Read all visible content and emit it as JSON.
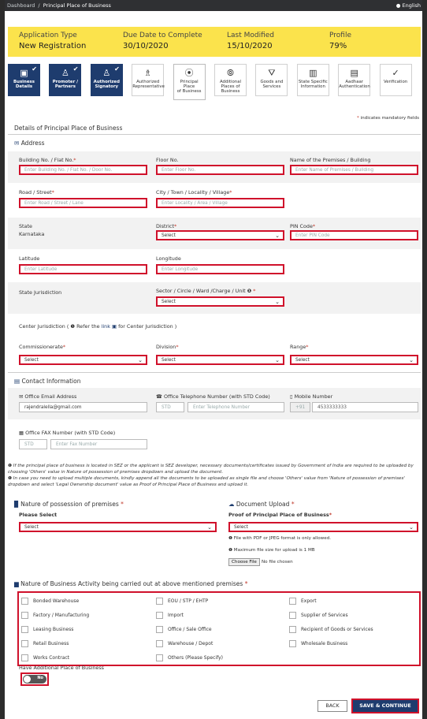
{
  "breadcrumb": {
    "home": "Dashboard",
    "current": "Principal Place of Business"
  },
  "language": "English",
  "info": [
    {
      "label": "Application Type",
      "value": "New Registration"
    },
    {
      "label": "Due Date to Complete",
      "value": "30/10/2020"
    },
    {
      "label": "Last Modified",
      "value": "15/10/2020"
    },
    {
      "label": "Profile",
      "value": "79%"
    }
  ],
  "steps": [
    {
      "l1": "Business",
      "l2": "Details",
      "icon": "briefcase-icon",
      "state": "done"
    },
    {
      "l1": "Promoter /",
      "l2": "Partners",
      "icon": "user-icon",
      "state": "done"
    },
    {
      "l1": "Authorized",
      "l2": "Signatory",
      "icon": "user-check-icon",
      "state": "done"
    },
    {
      "l1": "Authorized",
      "l2": "Representative",
      "icon": "users-icon",
      "state": ""
    },
    {
      "l1": "Principal Place",
      "l2": "of Business",
      "icon": "location-pin-icon",
      "state": "active"
    },
    {
      "l1": "Additional",
      "l2": "Places of",
      "l3": "Business",
      "icon": "map-pin-icon",
      "state": ""
    },
    {
      "l1": "Goods and",
      "l2": "Services",
      "icon": "goods-icon",
      "state": ""
    },
    {
      "l1": "State Specific",
      "l2": "Information",
      "icon": "document-icon",
      "state": ""
    },
    {
      "l1": "Aadhaar",
      "l2": "Authentication",
      "icon": "id-card-icon",
      "state": ""
    },
    {
      "l1": "Verification",
      "l2": "",
      "icon": "check-circle-icon",
      "state": ""
    }
  ],
  "mandatory_note": "indicates mandatory fields",
  "page_title": "Details of Principal Place of Business",
  "address_header": "Address",
  "fields": {
    "building": {
      "label": "Building No. / Flat No.",
      "placeholder": "Enter Building No. / Flat No. / Door No."
    },
    "floor": {
      "label": "Floor No.",
      "placeholder": "Enter Floor No."
    },
    "premises": {
      "label": "Name of the Premises / Building",
      "placeholder": "Enter Name of Premises / Building"
    },
    "road": {
      "label": "Road / Street",
      "placeholder": "Enter Road / Street / Lane"
    },
    "city": {
      "label": "City / Town / Locality / Village",
      "placeholder": "Enter Locality / Area / Village"
    },
    "state": {
      "label": "State",
      "value": "Karnataka"
    },
    "district": {
      "label": "District",
      "value": "Select"
    },
    "pin": {
      "label": "PIN Code",
      "placeholder": "Enter PIN Code"
    },
    "latitude": {
      "label": "Latitude",
      "placeholder": "Enter Latitude"
    },
    "longitude": {
      "label": "Longitude",
      "placeholder": "Enter Longitude"
    },
    "state_juris": {
      "label": "State Jurisdiction"
    },
    "sector": {
      "label": "Sector / Circle / Ward /Charge / Unit",
      "value": "Select"
    },
    "center_juris": {
      "prefix": "Center Jurisdiction ( ",
      "refer": "Refer the",
      "link": "link",
      "suffix": "for Center Jurisdiction )"
    },
    "commissionerate": {
      "label": "Commissionerate",
      "value": "Select"
    },
    "division": {
      "label": "Division",
      "value": "Select"
    },
    "range": {
      "label": "Range",
      "value": "Select"
    }
  },
  "contact": {
    "header": "Contact Information",
    "email_label": "Office Email Address",
    "email_value": "rajendralella@gmail.com",
    "phone_label": "Office Telephone Number (with STD Code)",
    "std_placeholder": "STD",
    "phone_placeholder": "Enter Telephone Number",
    "mobile_label": "Mobile Number",
    "mobile_code": "+91",
    "mobile_value": "4533333333",
    "fax_label": "Office FAX Number (with STD Code)",
    "fax_std": "STD",
    "fax_placeholder": "Enter Fax Number"
  },
  "notes": {
    "n1": "If the principal place of business is located in SEZ or the applicant is SEZ developer, necessary documents/certificates issued by Government of India are required to be uploaded by choosing 'Others' value in Nature of possession of premises dropdown and upload the document.",
    "n2": "In case you need to upload multiple documents, kindly append all the documents to be uploaded as single file and choose 'Others' value from 'Nature of possession of premises' dropdown and select 'Legal Ownership document' value as Proof of Principal Place of Business and upload it."
  },
  "possession": {
    "header": "Nature of possession of premises",
    "label": "Please Select",
    "value": "Select"
  },
  "upload": {
    "header": "Document Upload",
    "label": "Proof of Principal Place of Business",
    "value": "Select",
    "note1": "File with PDF or JPEG format is only allowed.",
    "note2": "Maximum file size for upload is 1 MB",
    "choose": "Choose File",
    "no_file": "No file chosen"
  },
  "activity": {
    "header": "Nature of Business Activity being carried out at above mentioned premises",
    "col1": [
      "Bonded Warehouse",
      "Factory / Manufacturing",
      "Leasing Business",
      "Retail Business",
      "Works Contract"
    ],
    "col2": [
      "EOU / STP / EHTP",
      "Import",
      "Office / Sale Office",
      "Warehouse / Depot",
      "Others (Please Specify)"
    ],
    "col3": [
      "Export",
      "Supplier of Services",
      "Recipient of Goods or Services",
      "Wholesale Business"
    ]
  },
  "additional": {
    "label": "Have Additional Place of Business",
    "toggle": "No"
  },
  "buttons": {
    "back": "BACK",
    "save": "SAVE & CONTINUE"
  },
  "colors": {
    "accent": "#1e3c6e",
    "highlight": "#d0112b",
    "info_bar": "#fbe34c"
  }
}
